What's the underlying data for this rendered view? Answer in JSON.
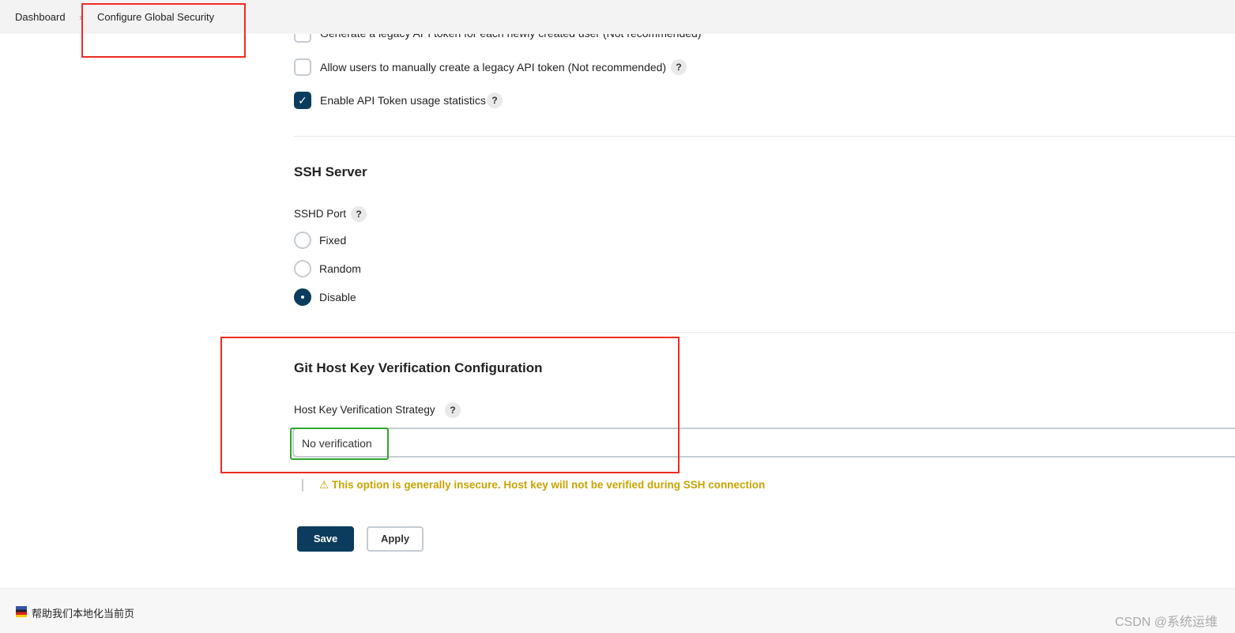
{
  "breadcrumb": {
    "items": [
      "Dashboard",
      "Configure Global Security"
    ],
    "separator": "›"
  },
  "api_token": {
    "options": [
      {
        "label": "Generate a legacy API token for each newly created user (Not recommended)",
        "checked": false
      },
      {
        "label": "Allow users to manually create a legacy API token (Not recommended)",
        "checked": false
      },
      {
        "label": "Enable API Token usage statistics",
        "checked": true
      }
    ]
  },
  "help_label": "?",
  "ssh": {
    "title": "SSH Server",
    "port_label": "SSHD Port",
    "options": [
      {
        "label": "Fixed",
        "selected": false
      },
      {
        "label": "Random",
        "selected": false
      },
      {
        "label": "Disable",
        "selected": true
      }
    ]
  },
  "git": {
    "title": "Git Host Key Verification Configuration",
    "strategy_label": "Host Key Verification Strategy",
    "strategy_value": "No verification",
    "warning": "This option is generally insecure. Host key will not be verified during SSH connection",
    "warning_icon": "warning-triangle-icon"
  },
  "buttons": {
    "save": "Save",
    "apply": "Apply"
  },
  "footer": {
    "localize": "帮助我们本地化当前页",
    "watermark": "CSDN @系统运维"
  },
  "colors": {
    "primary": "#0b3c5d",
    "warning": "#c8a400",
    "annotation_red": "#f02a23",
    "annotation_green": "#2da82d"
  }
}
